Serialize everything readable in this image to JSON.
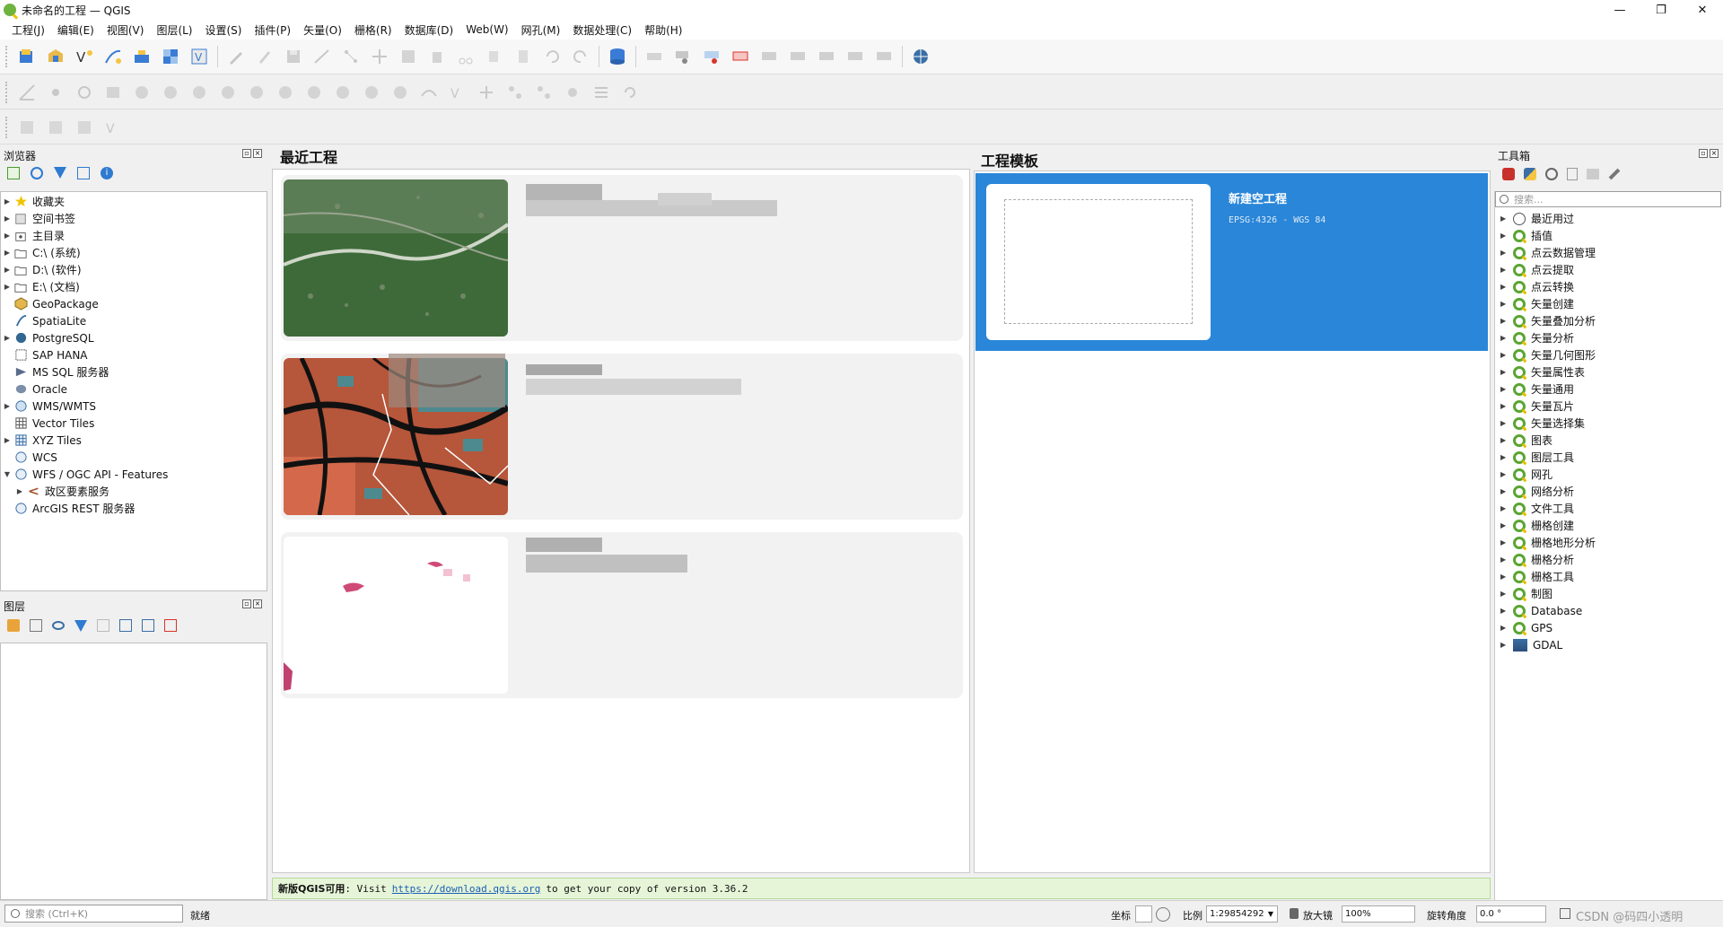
{
  "window": {
    "title": "未命名的工程 — QGIS",
    "controls": [
      "—",
      "❐",
      "✕"
    ]
  },
  "menu": [
    "工程(J)",
    "编辑(E)",
    "视图(V)",
    "图层(L)",
    "设置(S)",
    "插件(P)",
    "矢量(O)",
    "栅格(R)",
    "数据库(D)",
    "Web(W)",
    "网孔(M)",
    "数据处理(C)",
    "帮助(H)"
  ],
  "browser": {
    "title": "浏览器",
    "items": [
      {
        "label": "收藏夹",
        "icon": "star-icon",
        "expand": true
      },
      {
        "label": "空间书签",
        "icon": "bookmark-icon",
        "expand": true
      },
      {
        "label": "主目录",
        "icon": "home-folder-icon",
        "expand": true
      },
      {
        "label": "C:\\ (系统)",
        "icon": "folder-icon",
        "expand": true
      },
      {
        "label": "D:\\ (软件)",
        "icon": "folder-icon",
        "expand": true
      },
      {
        "label": "E:\\ (文档)",
        "icon": "folder-icon",
        "expand": true
      },
      {
        "label": "GeoPackage",
        "icon": "geopackage-icon",
        "expand": false
      },
      {
        "label": "SpatiaLite",
        "icon": "spatialite-icon",
        "expand": false
      },
      {
        "label": "PostgreSQL",
        "icon": "postgresql-icon",
        "expand": true
      },
      {
        "label": "SAP HANA",
        "icon": "sap-hana-icon",
        "expand": false
      },
      {
        "label": "MS SQL 服务器",
        "icon": "mssql-icon",
        "expand": false
      },
      {
        "label": "Oracle",
        "icon": "oracle-icon",
        "expand": false
      },
      {
        "label": "WMS/WMTS",
        "icon": "wms-icon",
        "expand": true
      },
      {
        "label": "Vector Tiles",
        "icon": "vector-tiles-icon",
        "expand": false
      },
      {
        "label": "XYZ Tiles",
        "icon": "xyz-tiles-icon",
        "expand": true
      },
      {
        "label": "WCS",
        "icon": "wcs-icon",
        "expand": false
      },
      {
        "label": "WFS / OGC API - Features",
        "icon": "wfs-icon",
        "expand": "open"
      },
      {
        "label": "政区要素服务",
        "icon": "wfs-child-icon",
        "expand": "child"
      },
      {
        "label": "ArcGIS REST 服务器",
        "icon": "arcgis-icon",
        "expand": false
      }
    ]
  },
  "layers": {
    "title": "图层"
  },
  "recent": {
    "title": "最近工程"
  },
  "templates": {
    "title": "工程模板",
    "card_title": "新建空工程",
    "card_sub": "EPSG:4326 - WGS 84"
  },
  "news": {
    "bold": "新版QGIS可用",
    "pre": ": Visit",
    "link": "https://download.qgis.org",
    "post": "to get your copy of version 3.36.2"
  },
  "toolbox": {
    "title": "工具箱",
    "search_placeholder": "搜索...",
    "items": [
      "最近用过",
      "插值",
      "点云数据管理",
      "点云提取",
      "点云转换",
      "矢量创建",
      "矢量叠加分析",
      "矢量分析",
      "矢量几何图形",
      "矢量属性表",
      "矢量通用",
      "矢量瓦片",
      "矢量选择集",
      "图表",
      "图层工具",
      "网孔",
      "网络分析",
      "文件工具",
      "栅格创建",
      "栅格地形分析",
      "栅格分析",
      "栅格工具",
      "制图",
      "Database",
      "GPS",
      "GDAL"
    ]
  },
  "status": {
    "search_placeholder": "搜索 (Ctrl+K)",
    "ready": "就绪",
    "coord_label": "坐标",
    "scale_label": "比例",
    "scale_value": "1:29854292",
    "magnifier_label": "放大镜",
    "magnifier_value": "100%",
    "rotation_label": "旋转角度",
    "rotation_value": "0.0 °",
    "watermark": "CSDN @码四小透明"
  }
}
